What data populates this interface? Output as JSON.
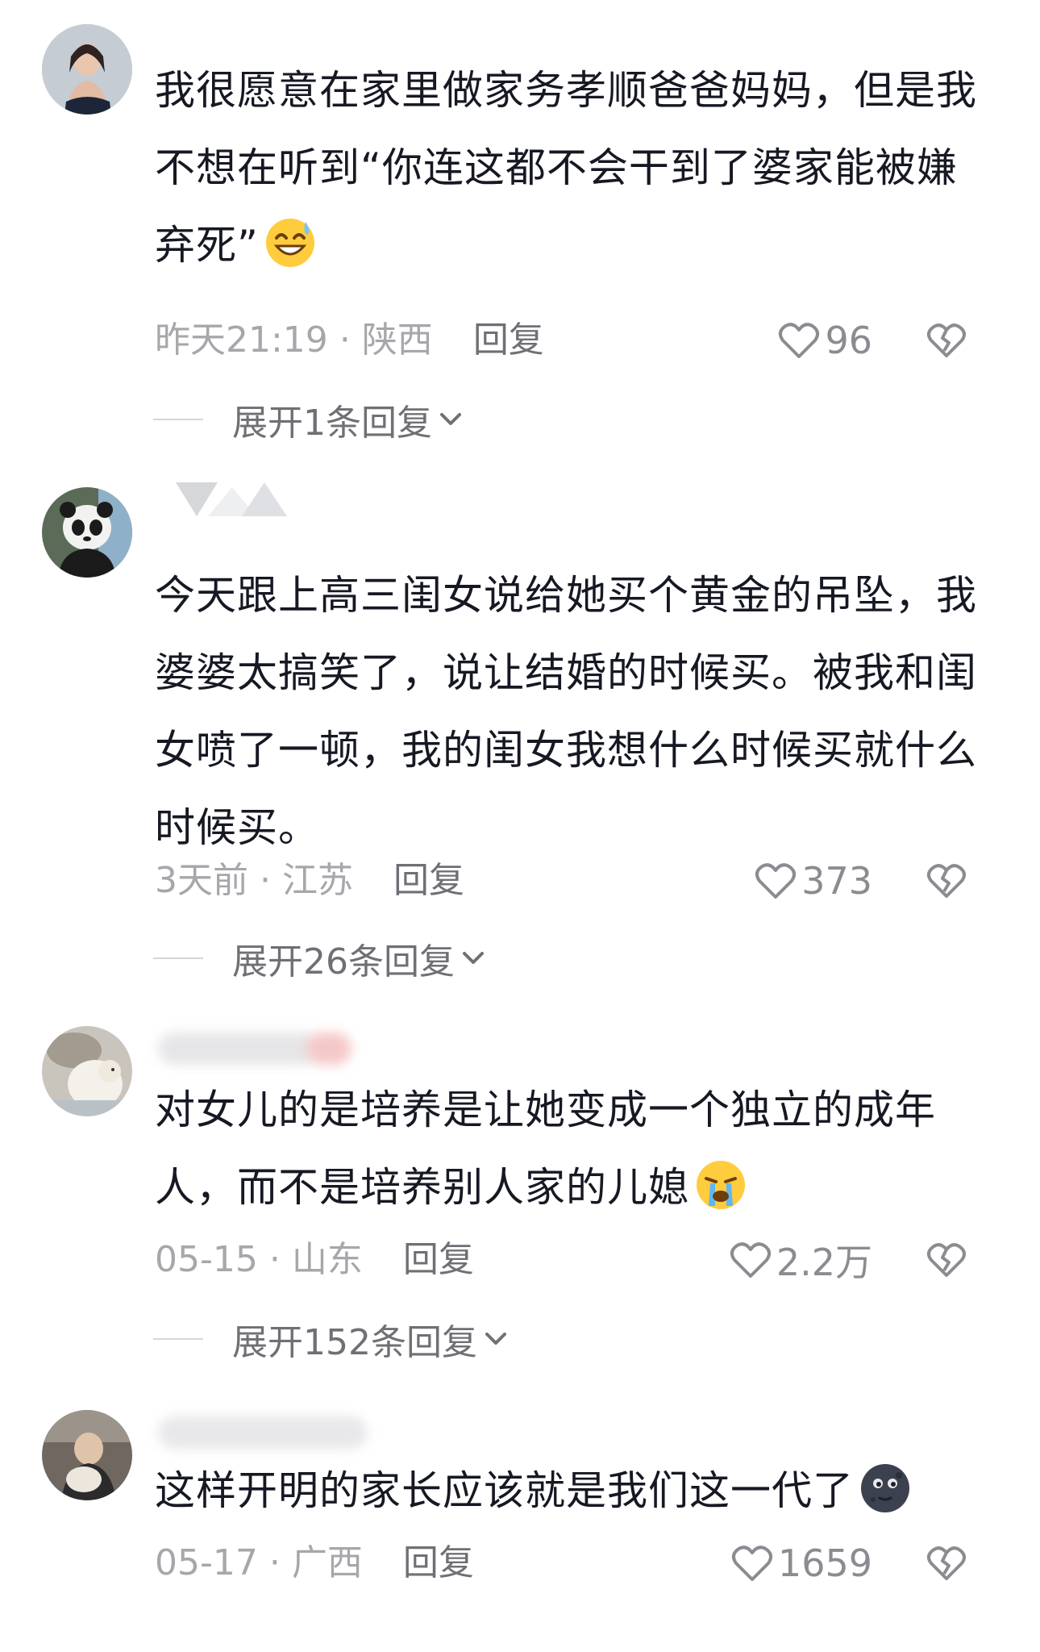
{
  "colors": {
    "text": "#161823",
    "meta": "#a6a7ab",
    "action": "#6f7075",
    "icon": "#8b8c91"
  },
  "comments": [
    {
      "text": "我很愿意在家里做家务孝顺爸爸妈妈，但是我不想在听到“你连这都不会干到了婆家能被嫌弃死”",
      "emoji": "grinning-sweat-emoji",
      "time": "昨天21:19",
      "separator": "·",
      "location": "陕西",
      "reply_label": "回复",
      "likes": "96",
      "expand_label": "展开1条回复"
    },
    {
      "text": "今天跟上高三闺女说给她买个黄金的吊坠，我婆婆太搞笑了，说让结婚的时候买。被我和闺女喷了一顿，我的闺女我想什么时候买就什么时候买。",
      "emoji": "",
      "time": "3天前",
      "separator": "·",
      "location": "江苏",
      "reply_label": "回复",
      "likes": "373",
      "expand_label": "展开26条回复"
    },
    {
      "text": "对女儿的是培养是让她变成一个独立的成年人，而不是培养别人家的儿媳",
      "emoji": "crying-emoji",
      "time": "05-15",
      "separator": "·",
      "location": "山东",
      "reply_label": "回复",
      "likes": "2.2万",
      "expand_label": "展开152条回复"
    },
    {
      "text": "这样开明的家长应该就是我们这一代了",
      "emoji": "new-moon-face-emoji",
      "time": "05-17",
      "separator": "·",
      "location": "广西",
      "reply_label": "回复",
      "likes": "1659",
      "expand_label": ""
    }
  ]
}
